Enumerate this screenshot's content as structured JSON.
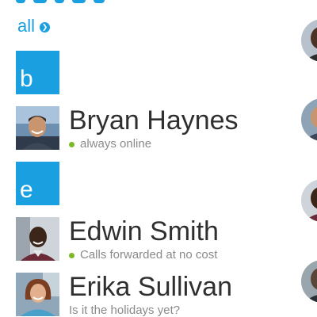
{
  "filter": {
    "label": "all",
    "arrow_icon": "chevron-right-circle-icon"
  },
  "groups": [
    {
      "letter": "b",
      "contacts": [
        {
          "name": "Bryan Haynes",
          "status": "always online",
          "presence": "online"
        }
      ]
    },
    {
      "letter": "e",
      "contacts": [
        {
          "name": "Edwin Smith",
          "status": "Calls forwarded at no cost",
          "presence": "online"
        },
        {
          "name": "Erika Sullivan",
          "status": "Is it the holidays yet?",
          "presence": "none"
        }
      ]
    }
  ],
  "colors": {
    "accent": "#1aa0e0",
    "presence_online": "#7cb928",
    "name_text": "#2f2f2f",
    "status_text": "#8a8a8a"
  }
}
